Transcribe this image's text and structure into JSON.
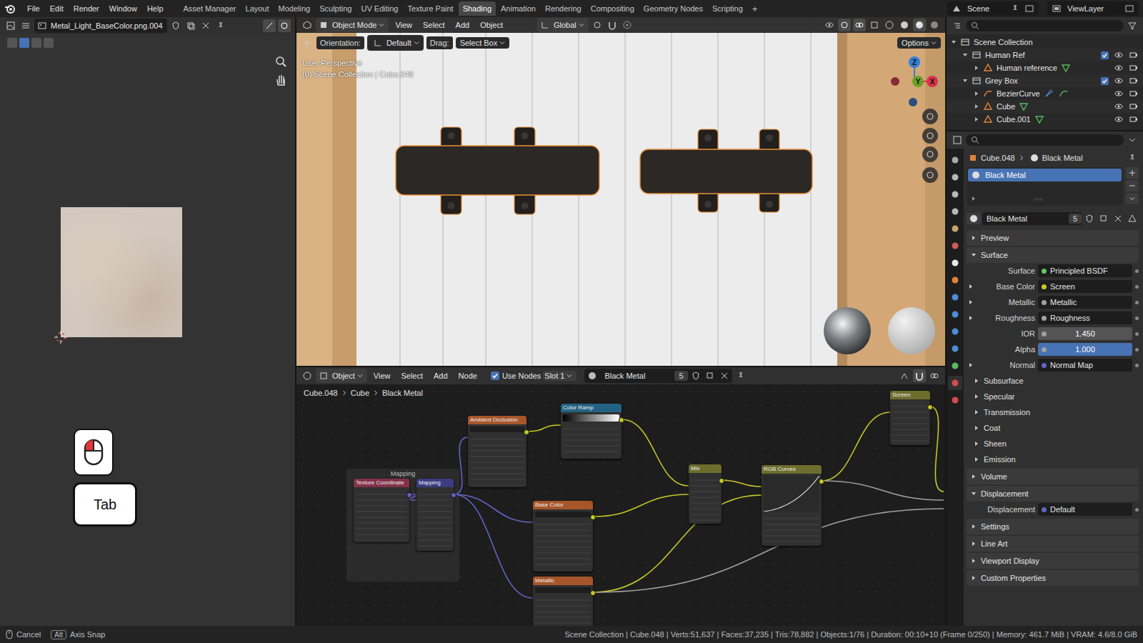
{
  "top_bar": {
    "menus": [
      "File",
      "Edit",
      "Render",
      "Window",
      "Help"
    ],
    "workspaces": [
      {
        "label": "Asset Manager",
        "selected": false
      },
      {
        "label": "Layout",
        "selected": false
      },
      {
        "label": "Modeling",
        "selected": false
      },
      {
        "label": "Sculpting",
        "selected": false
      },
      {
        "label": "UV Editing",
        "selected": false
      },
      {
        "label": "Texture Paint",
        "selected": false
      },
      {
        "label": "Shading",
        "selected": true
      },
      {
        "label": "Animation",
        "selected": false
      },
      {
        "label": "Rendering",
        "selected": false
      },
      {
        "label": "Compositing",
        "selected": false
      },
      {
        "label": "Geometry Nodes",
        "selected": false
      },
      {
        "label": "Scripting",
        "selected": false
      }
    ],
    "add_workspace": "+",
    "scene": "Scene",
    "view_layer": "ViewLayer"
  },
  "image_editor": {
    "image_name": "Metal_Light_BaseColor.png.004"
  },
  "screencast_keys": {
    "key": "Tab"
  },
  "viewport": {
    "mode": "Object Mode",
    "menus": [
      "View",
      "Select",
      "Add",
      "Object"
    ],
    "transform_orientation": "Global",
    "orientation_label": "Orientation:",
    "orientation": "Default",
    "drag_label": "Drag:",
    "drag": "Select Box",
    "options": "Options",
    "view_name": "User Perspective",
    "context": "(0) Scene Collection | Cube.048",
    "gizmo_axes": [
      {
        "label": "Z",
        "color": "#2f7fd8"
      },
      {
        "label": "Y",
        "color": "#6ba02a"
      },
      {
        "label": "X",
        "color": "#d8344a"
      }
    ]
  },
  "node_editor": {
    "object_dropdown": "Object",
    "menus": [
      "View",
      "Select",
      "Add",
      "Node"
    ],
    "use_nodes": {
      "label": "Use Nodes",
      "checked": true
    },
    "slot": "Slot 1",
    "material": "Black Metal",
    "users": "5",
    "breadcrumbs": [
      "Cube.048",
      "Cube",
      "Black Metal"
    ],
    "frames": [
      {
        "label": "Mapping"
      }
    ],
    "nodes": [
      {
        "title": "Texture Coordinate",
        "kind": "plain",
        "color": "#83314a"
      },
      {
        "title": "Mapping",
        "kind": "plain",
        "color": "#3c3c83"
      },
      {
        "title": "Ambient Occlusion",
        "kind": "image",
        "color": "#a6562a"
      },
      {
        "title": "Color Ramp",
        "kind": "ramp",
        "color": "#246283"
      },
      {
        "title": "Base Color",
        "kind": "image",
        "color": "#a6562a"
      },
      {
        "title": "Metallic",
        "kind": "image",
        "color": "#a6562a"
      },
      {
        "title": "Mix",
        "kind": "plain",
        "color": "#6d6d2e"
      },
      {
        "title": "RGB Curves",
        "kind": "curves",
        "color": "#6d6d2e"
      },
      {
        "title": "Screen",
        "kind": "plain",
        "color": "#6d6d2e"
      }
    ],
    "links": [
      {
        "from": 0,
        "to": 1,
        "color": "#6363c7"
      },
      {
        "from": 1,
        "to": 2,
        "color": "#6363c7"
      },
      {
        "from": 1,
        "to": 4,
        "color": "#6363c7"
      },
      {
        "from": 1,
        "to": 5,
        "color": "#6363c7"
      },
      {
        "from": 2,
        "to": 3,
        "color": "#c7c729"
      },
      {
        "from": 3,
        "to": 6,
        "color": "#c7c729"
      },
      {
        "from": 4,
        "to": 6,
        "color": "#c7c729"
      },
      {
        "from": 6,
        "to": 7,
        "color": "#c7c729"
      },
      {
        "from": 5,
        "to": 7,
        "color": "#c7c729"
      },
      {
        "from": 7,
        "to": 8,
        "color": "#c7c729"
      },
      {
        "from": 8,
        "to": null,
        "color": "#c7c729"
      },
      {
        "from": 7,
        "to": null,
        "color": "#a1a1a1"
      },
      {
        "from": 5,
        "to": null,
        "color": "#a1a1a1"
      }
    ]
  },
  "outliner": {
    "items": [
      {
        "label": "Scene Collection",
        "kind": "scene",
        "depth": 0,
        "expanded": true
      },
      {
        "label": "Human Ref",
        "kind": "collection",
        "depth": 1,
        "expanded": true,
        "checked": true,
        "visible": true
      },
      {
        "label": "Human reference",
        "kind": "mesh",
        "depth": 2,
        "expanded": false,
        "visible": true
      },
      {
        "label": "Grey Box",
        "kind": "collection",
        "depth": 1,
        "expanded": true,
        "checked": true,
        "visible": true
      },
      {
        "label": "BezierCurve",
        "kind": "curve",
        "depth": 2,
        "expanded": false,
        "visible": true
      },
      {
        "label": "Cube",
        "kind": "mesh",
        "depth": 2,
        "expanded": false,
        "visible": true
      },
      {
        "label": "Cube.001",
        "kind": "mesh",
        "depth": 2,
        "expanded": false,
        "visible": true
      }
    ]
  },
  "properties": {
    "tabs": [
      {
        "selected": false
      },
      {
        "selected": false
      },
      {
        "selected": false
      },
      {
        "selected": false
      },
      {
        "selected": false
      },
      {
        "selected": false
      },
      {
        "selected": false
      },
      {
        "selected": false
      },
      {
        "selected": false
      },
      {
        "selected": false
      },
      {
        "selected": false
      },
      {
        "selected": false
      },
      {
        "selected": false
      },
      {
        "selected": true
      },
      {
        "selected": false
      }
    ],
    "breadcrumb": [
      "Cube.048",
      "Black Metal"
    ],
    "material_slots": [
      {
        "label": "Black Metal",
        "selected": true
      }
    ],
    "material": "Black Metal",
    "users": "5",
    "rows": [
      {
        "kind": "panel",
        "label": "Preview",
        "expanded": false
      },
      {
        "kind": "panel",
        "label": "Surface",
        "expanded": true
      },
      {
        "kind": "link",
        "label": "Surface",
        "value": "Principled BSDF",
        "color": "#63c763",
        "expandable": false
      },
      {
        "kind": "link",
        "label": "Base Color",
        "value": "Screen",
        "color": "#c7c729",
        "expandable": true
      },
      {
        "kind": "link",
        "label": "Metallic",
        "value": "Metallic",
        "color": "#a1a1a1",
        "expandable": true
      },
      {
        "kind": "link",
        "label": "Roughness",
        "value": "Roughness",
        "color": "#a1a1a1",
        "expandable": true
      },
      {
        "kind": "number",
        "label": "IOR",
        "value": "1.450",
        "color": "#a1a1a1",
        "active": false
      },
      {
        "kind": "number",
        "label": "Alpha",
        "value": "1.000",
        "color": "#a1a1a1",
        "active": true
      },
      {
        "kind": "link",
        "label": "Normal",
        "value": "Normal Map",
        "color": "#6363c7",
        "expandable": true
      },
      {
        "kind": "subpanel",
        "label": "Subsurface",
        "expanded": false
      },
      {
        "kind": "subpanel",
        "label": "Specular",
        "expanded": false
      },
      {
        "kind": "subpanel",
        "label": "Transmission",
        "expanded": false
      },
      {
        "kind": "subpanel",
        "label": "Coat",
        "expanded": false
      },
      {
        "kind": "subpanel",
        "label": "Sheen",
        "expanded": false
      },
      {
        "kind": "subpanel",
        "label": "Emission",
        "expanded": false
      },
      {
        "kind": "panel",
        "label": "Volume",
        "expanded": false
      },
      {
        "kind": "panel",
        "label": "Displacement",
        "expanded": true
      },
      {
        "kind": "link",
        "label": "Displacement",
        "value": "Default",
        "color": "#6363c7",
        "expandable": false
      },
      {
        "kind": "panel",
        "label": "Settings",
        "expanded": false
      },
      {
        "kind": "panel",
        "label": "Line Art",
        "expanded": false
      },
      {
        "kind": "panel",
        "label": "Viewport Display",
        "expanded": false
      },
      {
        "kind": "panel",
        "label": "Custom Properties",
        "expanded": false
      }
    ]
  },
  "status_bar": {
    "hints": [
      {
        "kind": "mouse",
        "label": "Cancel"
      },
      {
        "kind": "key",
        "key": "Alt",
        "label": "Axis Snap"
      }
    ],
    "stats": "Scene Collection | Cube.048 | Verts:51,637 | Faces:37,235 | Tris:78,882 | Objects:1/76 | Duration: 00:10+10 (Frame 0/250) | Memory: 461.7 MiB | VRAM: 4.6/8.0 GiB"
  }
}
